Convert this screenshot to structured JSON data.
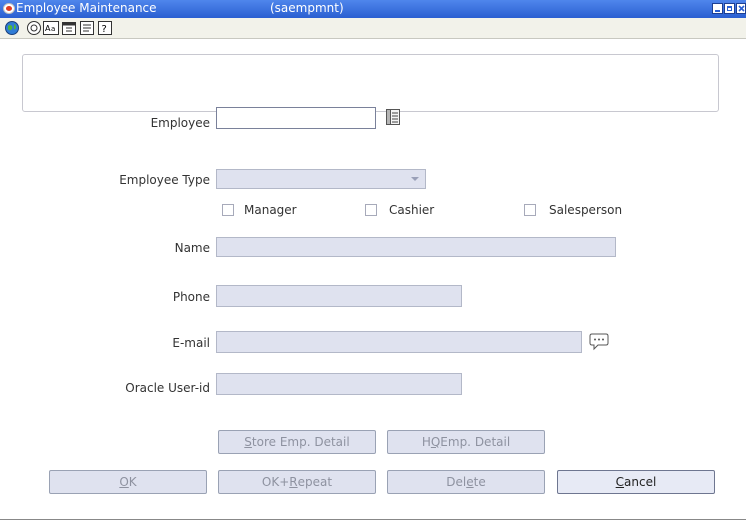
{
  "window": {
    "title": "Employee Maintenance",
    "code": "(saempmnt)"
  },
  "toolbar": {
    "icons": [
      "globe-icon",
      "help-circle-icon",
      "spell-check-icon",
      "calendar-icon",
      "notes-icon",
      "question-icon"
    ]
  },
  "form": {
    "employee": {
      "label": "Employee",
      "value": ""
    },
    "employee_type": {
      "label": "Employee Type",
      "value": ""
    },
    "checkboxes": [
      {
        "label": "Manager",
        "checked": false
      },
      {
        "label": "Cashier",
        "checked": false
      },
      {
        "label": "Salesperson",
        "checked": false
      }
    ],
    "name": {
      "label": "Name",
      "value": ""
    },
    "phone": {
      "label": "Phone",
      "value": ""
    },
    "email": {
      "label": "E-mail",
      "value": ""
    },
    "oracle_user": {
      "label": "Oracle User-id",
      "value": ""
    }
  },
  "detail_buttons": {
    "store": {
      "pre": "",
      "key": "S",
      "post": "tore Emp. Detail"
    },
    "hq": {
      "pre": "H",
      "key": "Q",
      "post": " Emp. Detail"
    }
  },
  "buttons": {
    "ok": {
      "pre": "",
      "key": "O",
      "post": "K"
    },
    "ok_repeat": {
      "pre": "OK+",
      "key": "R",
      "post": "epeat"
    },
    "delete": {
      "pre": "Del",
      "key": "e",
      "post": "te"
    },
    "cancel": {
      "pre": "",
      "key": "C",
      "post": "ancel"
    }
  },
  "colors": {
    "titlebar": "#2a5fd1",
    "field_disabled": "#dfe2ef",
    "button_disabled_text": "#8e92a0"
  }
}
